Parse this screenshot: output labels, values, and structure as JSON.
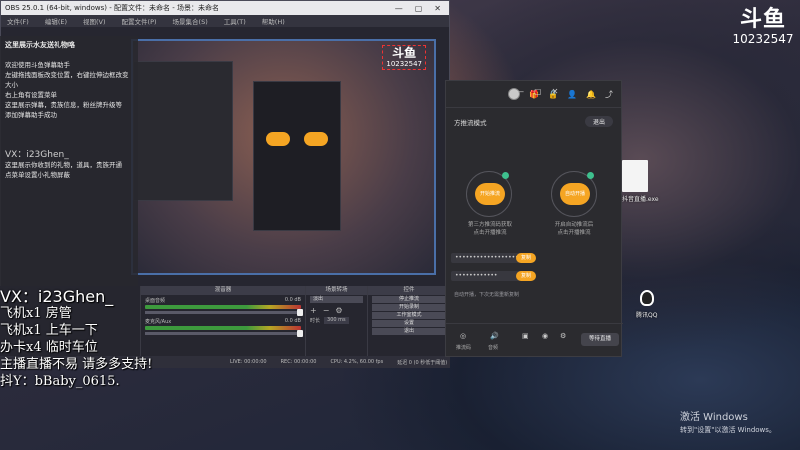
{
  "overlay_logo": {
    "brand": "斗鱼",
    "room_id": "10232547"
  },
  "obs": {
    "title": "OBS 25.0.1 (64-bit, windows) - 配置文件：未命名 - 场景：未命名",
    "menu": [
      "文件(F)",
      "编辑(E)",
      "视图(V)",
      "配置文件(P)",
      "场景集合(S)",
      "工具(T)",
      "帮助(H)"
    ],
    "preview_logo": {
      "brand": "斗鱼",
      "room_id": "10232547"
    },
    "mixer_title": "混音器",
    "mixer_channels": [
      {
        "name": "桌面音频",
        "db": "0.0 dB"
      },
      {
        "name": "麦克风/Aux",
        "db": "0.0 dB"
      }
    ],
    "transition_title": "场景转场",
    "transition_value": "淡出",
    "duration_label": "时长",
    "duration_value": "300 ms",
    "controls_title": "控件",
    "controls": [
      "停止推流",
      "开始录制",
      "工作室模式",
      "设置",
      "退出"
    ],
    "status": {
      "live": "LIVE: 00:00:00",
      "rec": "REC: 00:00:00",
      "cpu": "CPU: 4.2%, 60.00 fps",
      "dropped": "延迟 0 (0 秒低于阈值)"
    }
  },
  "side_panel": {
    "header": "这里展示水友送礼物咯",
    "lines": [
      "欢迎使用斗鱼弹幕助手",
      "左键拖拽面板改变位置，右键拉伸边框改变大小",
      "右上角有设置菜单",
      "这里展示弹幕，贵族信息，粉丝牌升级等",
      "添加弹幕助手成功"
    ],
    "wx_line": "VX：i23Ghen_",
    "hint_lines": [
      "这里展示你收到的礼物，道具，贵族开通",
      "点菜单设置小礼物屏蔽"
    ]
  },
  "chat_lines": [
    "VX：i23Ghen_",
    "飞机x1 房管",
    "飞机x1 上车一下",
    "办卡x4 临时车位",
    "主播直播不易 请多多支持!",
    "抖Y：bBaby_0615."
  ],
  "douyu_app": {
    "top_icons": [
      "gift-icon",
      "lock-icon",
      "user-icon",
      "bell-icon",
      "share-icon"
    ],
    "window_buttons": [
      "—",
      "▢",
      "✕"
    ],
    "mode_title": "方推流模式",
    "exit_label": "退出",
    "left_circle_label": "开始推流",
    "left_circle_caption": "第三方推流码获取\n点击开播推流",
    "right_circle_label": "自动开播",
    "right_circle_caption": "开启自动推流后\n点击开播推流",
    "field_1": "••••••••••••••••••",
    "field_2": "••••••••••••",
    "copy_label": "复制",
    "note": "自动开播，下次无需重新复制",
    "bottom_items": [
      {
        "icon": "camera-icon",
        "label": "推流码"
      },
      {
        "icon": "volume-icon",
        "label": "音频"
      }
    ],
    "start_label": "等待直播"
  },
  "desktop": {
    "file_label": "抖音直播.exe",
    "qq_label": "腾讯QQ"
  },
  "activate": {
    "line1": "激活 Windows",
    "line2": "转到\"设置\"以激活 Windows。"
  }
}
